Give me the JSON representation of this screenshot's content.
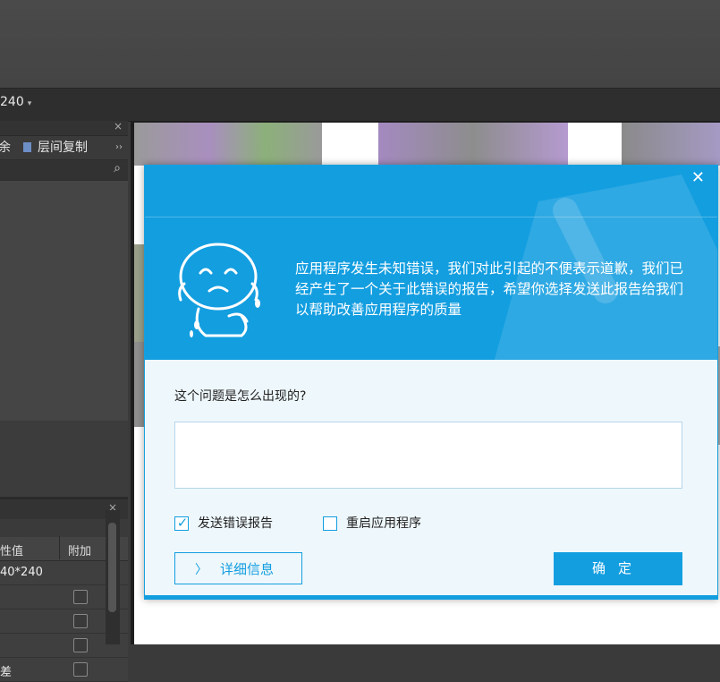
{
  "toolbar": {
    "zoom_value": "240",
    "zoom_arrow": "▾"
  },
  "left_panel": {
    "close_glyph": "×",
    "tool_label_partial": "余",
    "tool_label": "层间复制",
    "more_glyph": "››",
    "search_icon": "⌕"
  },
  "props_panel": {
    "close_glyph": "×",
    "col_value": "性值",
    "col_add": "附加",
    "rows": [
      {
        "value": "40*240",
        "checkbox": false
      },
      {
        "value": "",
        "checkbox": true
      },
      {
        "value": "",
        "checkbox": true
      },
      {
        "value": "",
        "checkbox": true
      },
      {
        "value": "差",
        "checkbox": true
      }
    ]
  },
  "dialog": {
    "close_label": "✕",
    "message": "应用程序发生未知错误，我们对此引起的不便表示道歉，我们已经产生了一个关于此错误的报告，希望你选择发送此报告给我们以帮助改善应用程序的质量",
    "question": "这个问题是怎么出现的?",
    "textarea_value": "",
    "send_report": {
      "label": "发送错误报告",
      "checked": true
    },
    "restart_app": {
      "label": "重启应用程序",
      "checked": false
    },
    "details_label": "详细信息",
    "ok_label": "确定",
    "colors": {
      "accent": "#139ee0",
      "body_bg": "#eef7fb"
    }
  }
}
